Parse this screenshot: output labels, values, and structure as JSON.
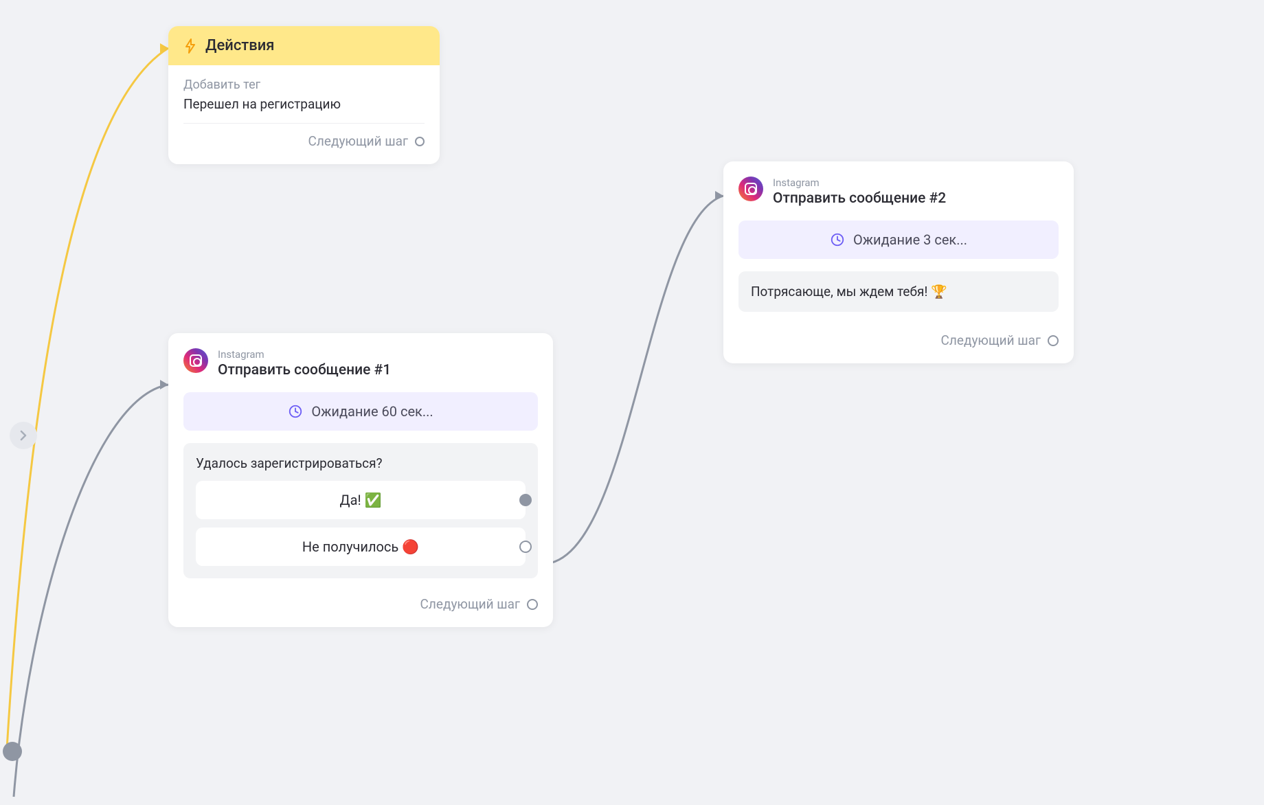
{
  "actions_card": {
    "header_title": "Действия",
    "tag_label": "Добавить тег",
    "tag_value": "Перешел на регистрацию",
    "next_step": "Следующий шаг"
  },
  "msg1": {
    "channel": "Instagram",
    "title": "Отправить сообщение #1",
    "wait": "Ожидание 60 сек...",
    "question": "Удалось зарегистрироваться?",
    "answer_yes": "Да! ✅",
    "answer_no": "Не получилось 🔴",
    "next_step": "Следующий шаг"
  },
  "msg2": {
    "channel": "Instagram",
    "title": "Отправить сообщение #2",
    "wait": "Ожидание 3 сек...",
    "content": "Потрясающе, мы ждем тебя! 🏆",
    "next_step": "Следующий шаг"
  }
}
